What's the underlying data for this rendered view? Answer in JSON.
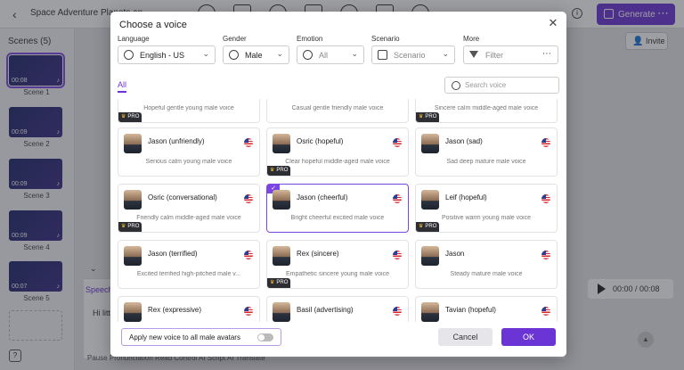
{
  "background": {
    "project_title": "Space Adventure Planets an",
    "generate_label": "Generate",
    "invite_label": "Invite",
    "scenes_title": "Scenes (5)",
    "scenes": [
      {
        "label": "Scene 1",
        "duration": "00:08"
      },
      {
        "label": "Scene 2",
        "duration": "00:09"
      },
      {
        "label": "Scene 3",
        "duration": "00:09"
      },
      {
        "label": "Scene 4",
        "duration": "00:09"
      },
      {
        "label": "Scene 5",
        "duration": "00:07"
      }
    ],
    "speech_tab": "Speech",
    "speech_text": "Hi littl",
    "time_readout": "00:00 / 00:08",
    "bottom_tools": "Pause   Pronunciation   Read Control   AI Script   AI Translate"
  },
  "modal": {
    "title": "Choose a voice",
    "filters": {
      "language": {
        "label": "Language",
        "value": "English - US"
      },
      "gender": {
        "label": "Gender",
        "value": "Male"
      },
      "emotion": {
        "label": "Emotion",
        "value": "All"
      },
      "scenario": {
        "label": "Scenario",
        "value": "Scenario"
      },
      "more": {
        "label": "More",
        "value": "Filter"
      }
    },
    "tab_all": "All",
    "search_placeholder": "Search voice",
    "pro_label": "PRO",
    "top_partial_desc": [
      "Hopeful gentle young male voice",
      "Casual gentle friendly male voice",
      "Sincere calm middle-aged male voice"
    ],
    "voices": [
      {
        "name": "Jason (unfriendly)",
        "desc": "Serious calm young male voice"
      },
      {
        "name": "Osric (hopeful)",
        "desc": "Clear hopeful middle-aged male voice"
      },
      {
        "name": "Jason (sad)",
        "desc": "Sad deep mature male voice"
      },
      {
        "name": "Osric (conversational)",
        "desc": "Friendly calm middle-aged male voice"
      },
      {
        "name": "Jason (cheerful)",
        "desc": "Bright cheerful excited male voice"
      },
      {
        "name": "Leif (hopeful)",
        "desc": "Positive warm young male voice"
      },
      {
        "name": "Jason (terrified)",
        "desc": "Excited terrified high-pitched male v..."
      },
      {
        "name": "Rex (sincere)",
        "desc": "Empathetic sincere young male voice"
      },
      {
        "name": "Jason",
        "desc": "Steady mature male voice"
      },
      {
        "name": "Rex (expressive)",
        "desc": ""
      },
      {
        "name": "Basil (advertising)",
        "desc": ""
      },
      {
        "name": "Tavian (hopeful)",
        "desc": ""
      }
    ],
    "apply_label": "Apply new voice to all male avatars",
    "cancel_label": "Cancel",
    "ok_label": "OK"
  }
}
